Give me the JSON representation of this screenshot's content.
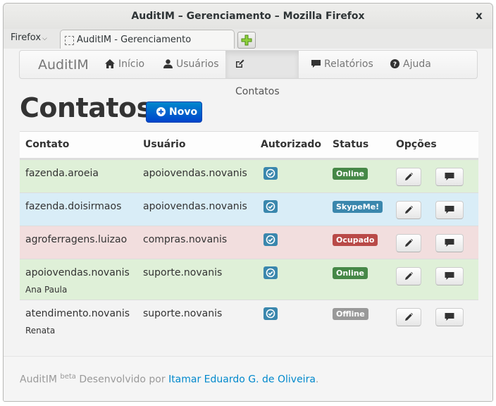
{
  "window": {
    "title": "AuditIM – Gerenciamento – Mozilla Firefox",
    "close": "x"
  },
  "browser": {
    "menu_label": "Firefox",
    "tab_title": "AuditIM - Gerenciamento"
  },
  "navbar": {
    "brand": "AuditIM",
    "items": [
      {
        "label": "Início",
        "icon": "home-icon",
        "active": false
      },
      {
        "label": "Usuários",
        "icon": "user-icon",
        "active": false
      },
      {
        "label": "Contatos",
        "icon": "edit-icon",
        "active": true
      },
      {
        "label": "Relatórios",
        "icon": "comment-icon",
        "active": false
      },
      {
        "label": "Ajuda",
        "icon": "question-icon",
        "active": false
      }
    ]
  },
  "page": {
    "title": "Contatos",
    "new_button": "Novo"
  },
  "table": {
    "headers": [
      "Contato",
      "Usuário",
      "Autorizado",
      "Status",
      "Opções"
    ],
    "rows": [
      {
        "contato": "fazenda.aroeia",
        "sub": "",
        "usuario": "apoiovendas.novanis",
        "status": "Online",
        "status_color": "#468847",
        "row_style": "success"
      },
      {
        "contato": "fazenda.doisirmaos",
        "sub": "",
        "usuario": "apoiovendas.novanis",
        "status": "SkypeMe!",
        "status_color": "#3a87ad",
        "row_style": "info"
      },
      {
        "contato": "agroferragens.luizao",
        "sub": "",
        "usuario": "compras.novanis",
        "status": "Ocupado",
        "status_color": "#b94a48",
        "row_style": "error"
      },
      {
        "contato": "apoiovendas.novanis",
        "sub": "Ana Paula",
        "usuario": "suporte.novanis",
        "status": "Online",
        "status_color": "#468847",
        "row_style": "success"
      },
      {
        "contato": "atendimento.novanis",
        "sub": "Renata",
        "usuario": "suporte.novanis",
        "status": "Offline",
        "status_color": "#999999",
        "row_style": "plain"
      }
    ]
  },
  "footer": {
    "brand": "AuditIM",
    "beta": "beta",
    "text": "Desenvolvido por",
    "author": "Itamar Eduardo G. de Oliveira",
    "end": "."
  }
}
